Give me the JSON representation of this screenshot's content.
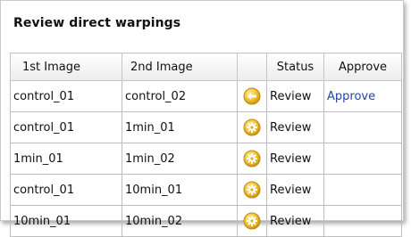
{
  "panel": {
    "title": "Review direct warpings"
  },
  "table": {
    "headers": {
      "image1": "1st Image",
      "image2": "2nd Image",
      "icon": "",
      "status": "Status",
      "approve": "Approve"
    },
    "rows": [
      {
        "image1": "control_01",
        "image2": "control_02",
        "icon": "undo-arrow-icon",
        "status": "Review",
        "approve": "Approve"
      },
      {
        "image1": "control_01",
        "image2": "1min_01",
        "icon": "gear-icon",
        "status": "Review",
        "approve": ""
      },
      {
        "image1": "1min_01",
        "image2": "1min_02",
        "icon": "gear-icon",
        "status": "Review",
        "approve": ""
      },
      {
        "image1": "control_01",
        "image2": "10min_01",
        "icon": "gear-icon",
        "status": "Review",
        "approve": ""
      },
      {
        "image1": "10min_01",
        "image2": "10min_02",
        "icon": "gear-icon",
        "status": "Review",
        "approve": ""
      }
    ]
  },
  "colors": {
    "icon_fill": "#f2c12e",
    "icon_stroke": "#b88a10",
    "link": "#2244aa"
  }
}
